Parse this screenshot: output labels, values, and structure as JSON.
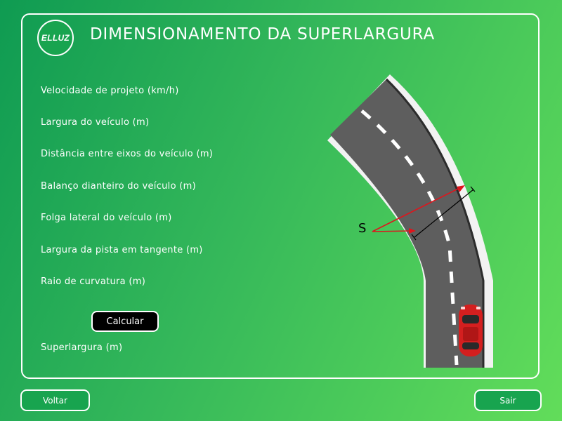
{
  "header": {
    "logo_text": "ELLUZ",
    "title": "DIMENSIONAMENTO DA SUPERLARGURA"
  },
  "form": {
    "fields": [
      {
        "label": "Velocidade de projeto (km/h)"
      },
      {
        "label": "Largura do veículo (m)"
      },
      {
        "label": "Distância entre eixos do veículo (m)"
      },
      {
        "label": "Balanço dianteiro do veículo (m)"
      },
      {
        "label": "Folga lateral do veículo (m)"
      },
      {
        "label": "Largura da pista em tangente (m)"
      },
      {
        "label": "Raio de curvatura (m)"
      }
    ],
    "calculate_label": "Calcular",
    "result_label": "Superlargura (m)"
  },
  "illustration": {
    "s_label": "S",
    "arrow_color": "#e0141c",
    "asphalt_color": "#5e5e5e",
    "car_color": "#d41f1f"
  },
  "footer": {
    "back_label": "Voltar",
    "exit_label": "Sair"
  },
  "colors": {
    "background_start": "#0f9b52",
    "background_end": "#62dd5a",
    "button_green": "#18a44f"
  }
}
